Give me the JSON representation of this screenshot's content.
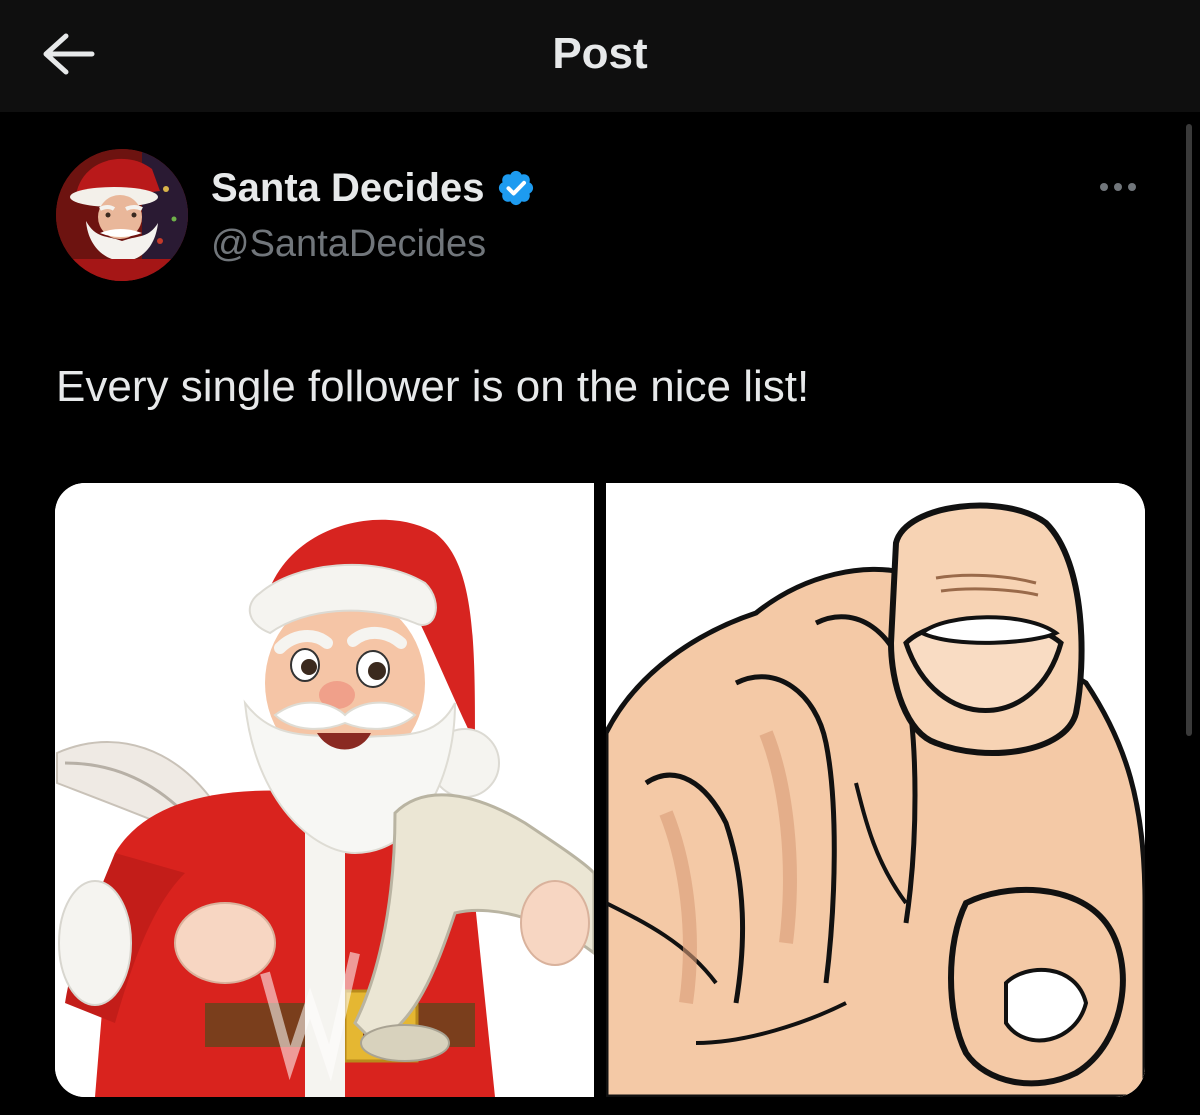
{
  "header": {
    "title": "Post",
    "back_icon": "arrow-left-icon"
  },
  "post": {
    "author": {
      "display_name": "Santa Decides",
      "handle": "@SantaDecides",
      "verified": true,
      "verified_color": "#1d9bf0"
    },
    "more_icon": "more-horizontal-icon",
    "text": "Every single follower is on the nice list!",
    "media": [
      {
        "alt": "santa-with-quill-and-scroll"
      },
      {
        "alt": "pointing-finger"
      }
    ]
  },
  "colors": {
    "background": "#000000",
    "header_bg": "#0f0f0f",
    "primary_text": "#e7e9ea",
    "secondary_text": "#71767b",
    "accent": "#1d9bf0"
  }
}
